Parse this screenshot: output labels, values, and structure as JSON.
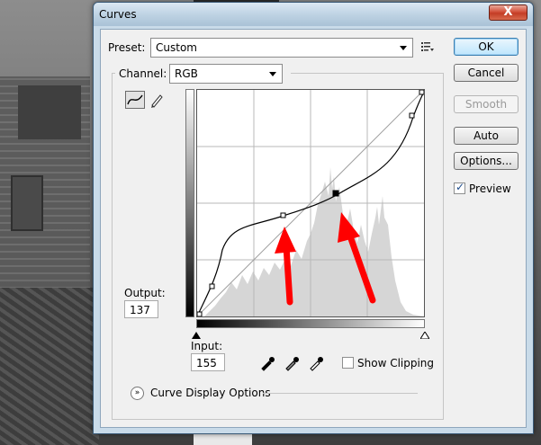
{
  "window": {
    "title": "Curves",
    "close_label": "X"
  },
  "preset": {
    "label": "Preset:",
    "value": "Custom"
  },
  "channel": {
    "label": "Channel:",
    "value": "RGB"
  },
  "buttons": {
    "ok": "OK",
    "cancel": "Cancel",
    "smooth": "Smooth",
    "auto": "Auto",
    "options": "Options..."
  },
  "preview": {
    "label": "Preview",
    "checked": true
  },
  "output": {
    "label": "Output:",
    "value": "137"
  },
  "input": {
    "label": "Input:",
    "value": "155"
  },
  "show_clipping": {
    "label": "Show Clipping",
    "checked": false
  },
  "curve_display_options": {
    "label": "Curve Display Options"
  },
  "curve": {
    "points": [
      [
        0,
        0
      ],
      [
        38,
        51
      ],
      [
        236,
        175
      ],
      [
        255,
        255
      ]
    ],
    "selected_point": [
      95,
      112
    ],
    "active_point": [
      155,
      137
    ],
    "note": ""
  },
  "icons": [
    "preset-menu-icon",
    "curve-tool-icon",
    "pencil-tool-icon",
    "black-eyedropper-icon",
    "gray-eyedropper-icon",
    "white-eyedropper-icon",
    "expand-chevron-icon"
  ],
  "annotations": {
    "arrow_color": "#ff0000"
  }
}
